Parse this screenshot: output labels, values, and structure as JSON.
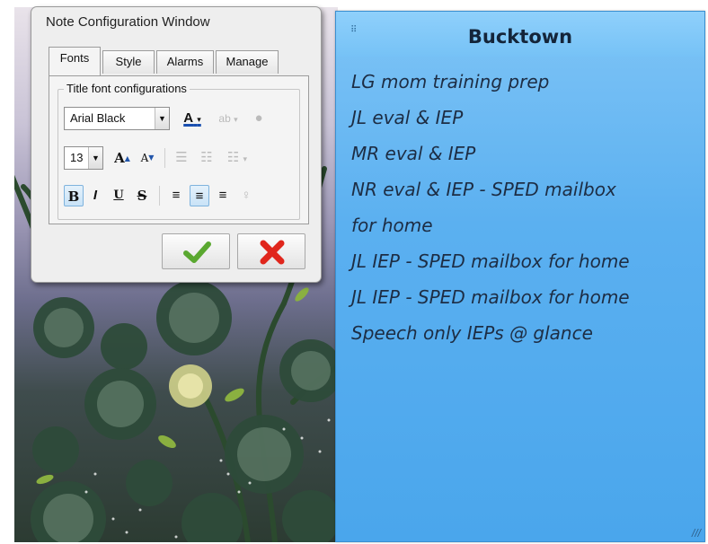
{
  "config_window": {
    "title": "Note Configuration Window",
    "tabs": [
      {
        "label": "Fonts",
        "active": true
      },
      {
        "label": "Style",
        "active": false
      },
      {
        "label": "Alarms",
        "active": false
      },
      {
        "label": "Manage",
        "active": false
      }
    ],
    "group_label": "Title font configurations",
    "font_family": "Arial Black",
    "font_size": "13",
    "toolbar_row1": [
      "font-color-icon",
      "highlight-color-icon",
      "globe-icon"
    ],
    "toolbar_row2": [
      "grow-font-icon",
      "shrink-font-icon",
      "bullet-list-icon",
      "decrease-indent-icon",
      "increase-indent-icon"
    ],
    "toolbar_row3": [
      "bold-icon",
      "italic-icon",
      "underline-icon",
      "strikethrough-icon",
      "align-left-icon",
      "align-center-icon",
      "align-right-icon",
      "pin-icon"
    ],
    "ok_icon": "checkmark-icon",
    "cancel_icon": "red-x-icon",
    "colors": {
      "ok": "#5aa830",
      "cancel": "#e0261c"
    }
  },
  "note": {
    "title": "Bucktown",
    "lines": [
      "LG mom training prep",
      "JL eval & IEP",
      "MR eval & IEP",
      "NR eval & IEP - SPED mailbox",
      "for home",
      "JL IEP - SPED mailbox for home",
      "JL IEP - SPED mailbox for home",
      "Speech only IEPs @ glance"
    ],
    "colors": {
      "background": "#5bb0f0",
      "header": "#7ec4f6",
      "text": "#1d2d44"
    }
  }
}
